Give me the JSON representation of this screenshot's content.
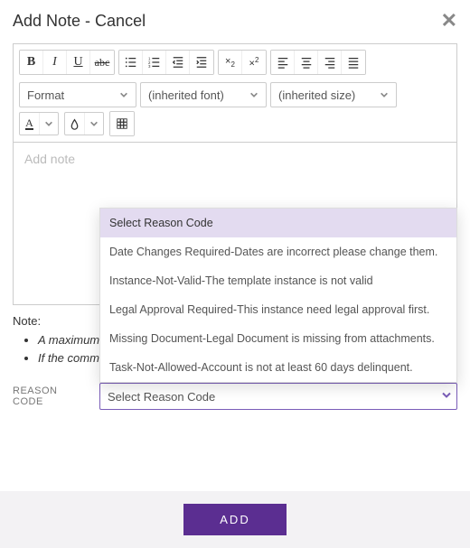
{
  "header": {
    "title": "Add Note - Cancel"
  },
  "toolbar": {
    "format_label": "Format",
    "font_label": "(inherited font)",
    "size_label": "(inherited size)"
  },
  "editor": {
    "placeholder": "Add note"
  },
  "notes": {
    "label": "Note:",
    "items": [
      "A maximum",
      "If the commo                                                                                                                      ved due to security reasons. To"
    ]
  },
  "reason": {
    "field_label": "REASON CODE",
    "selected": "Select Reason Code",
    "options": [
      "Select Reason Code",
      "Date Changes Required-Dates are incorrect please change them.",
      "Instance-Not-Valid-The template instance is not valid",
      "Legal Approval Required-This instance need legal approval first.",
      "Missing Document-Legal Document is missing from attachments.",
      "Task-Not-Allowed-Account is not at least 60 days delinquent."
    ]
  },
  "footer": {
    "add_label": "ADD"
  }
}
